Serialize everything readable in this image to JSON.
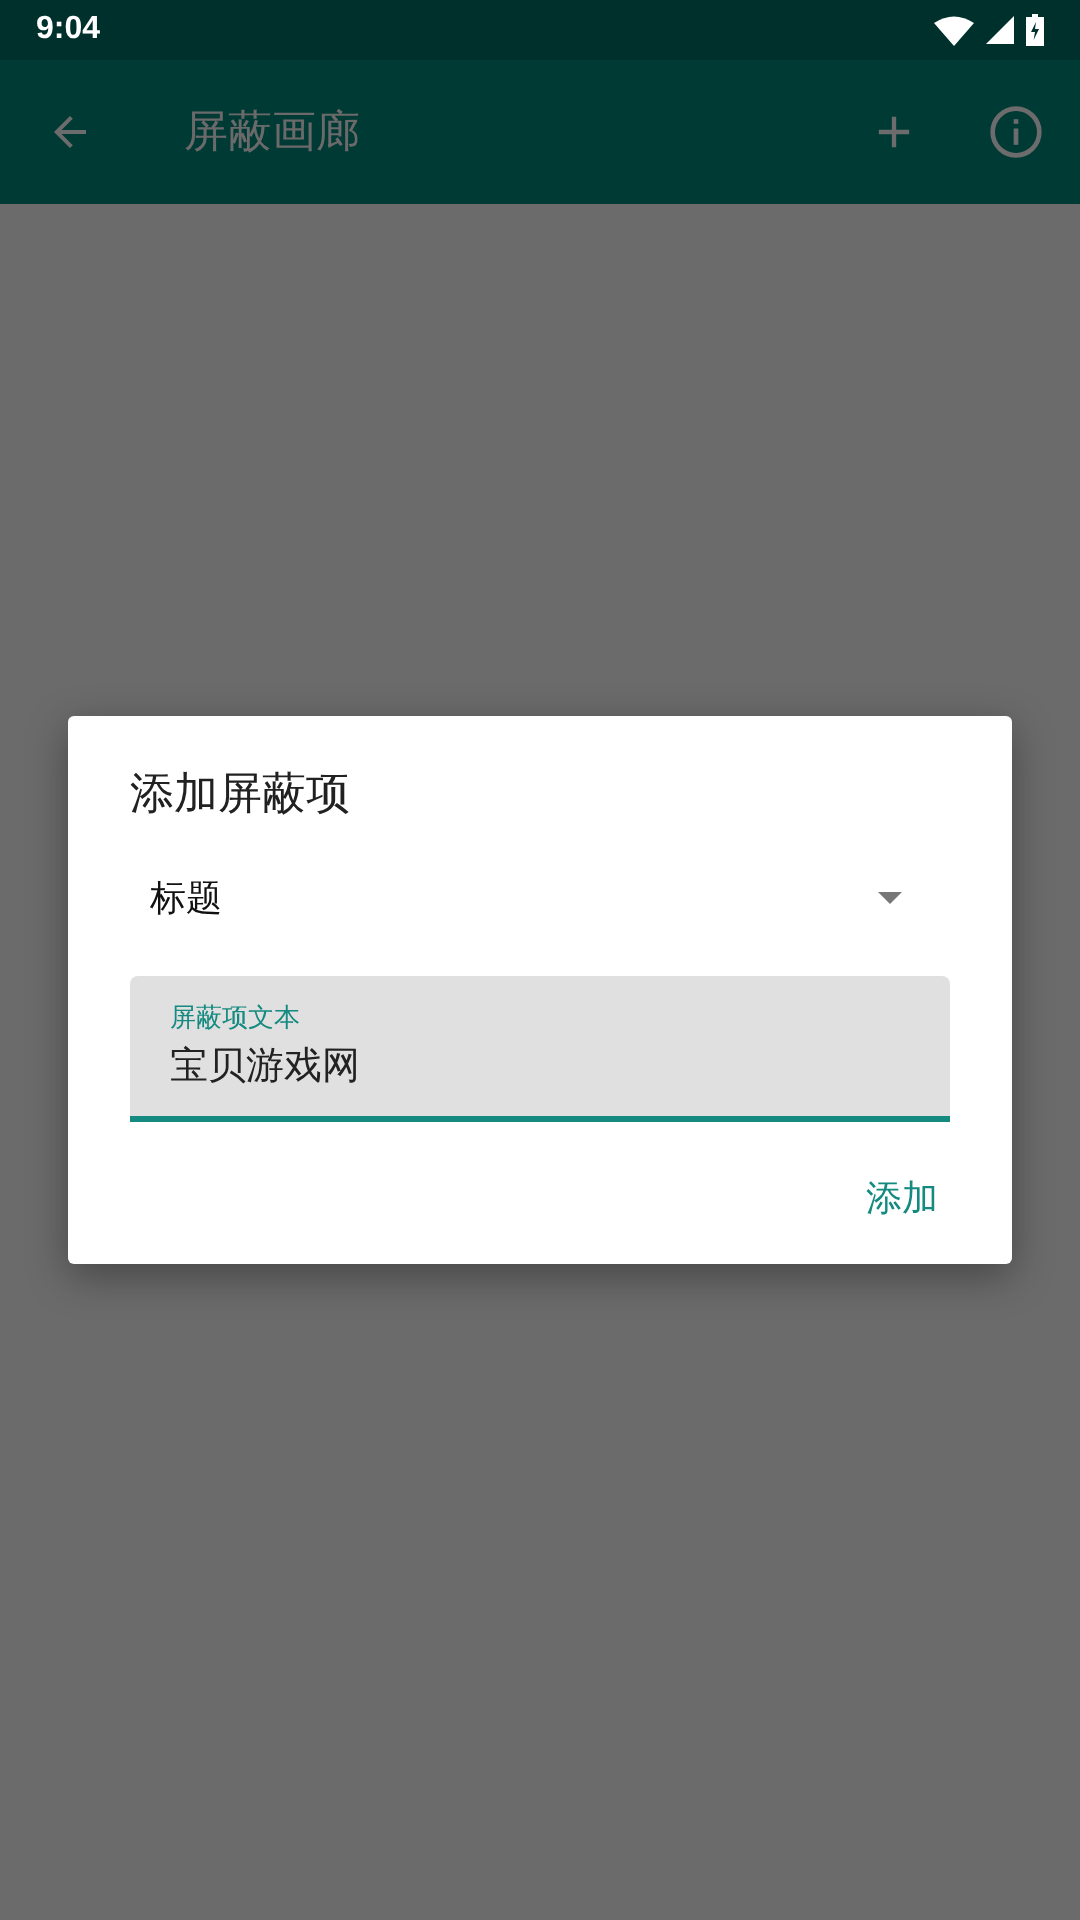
{
  "status_bar": {
    "time": "9:04"
  },
  "app_bar": {
    "title": "屏蔽画廊"
  },
  "dialog": {
    "title": "添加屏蔽项",
    "dropdown": {
      "value": "标题"
    },
    "field": {
      "label": "屏蔽项文本",
      "value": "宝贝游戏网",
      "focused": true
    },
    "action": "添加"
  }
}
